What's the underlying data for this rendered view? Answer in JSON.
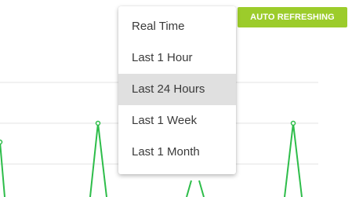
{
  "toolbar": {
    "auto_refresh_label": "AUTO REFRESHING",
    "auto_refresh_color": "#9ccc2b"
  },
  "time_range_menu": {
    "selected_index": 2,
    "options": [
      "Real Time",
      "Last 1 Hour",
      "Last 24 Hours",
      "Last 1 Week",
      "Last 1 Month"
    ]
  },
  "chart_data": {
    "type": "line",
    "line_color": "#2ebd4a",
    "grid": true
  }
}
